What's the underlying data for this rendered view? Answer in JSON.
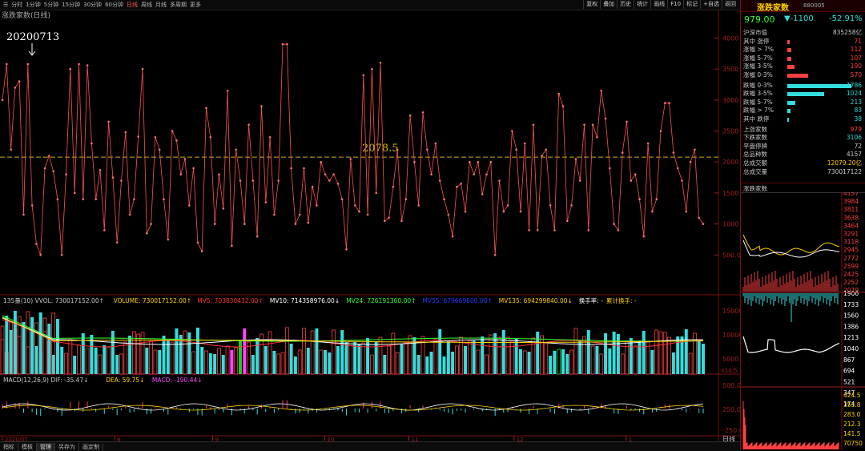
{
  "topbar": {
    "tabs": [
      "分时",
      "1分钟",
      "5分钟",
      "15分钟",
      "30分钟",
      "60分钟",
      "日线",
      "周线",
      "月线",
      "多周期",
      "更多"
    ],
    "active_index": 6,
    "right_buttons": [
      "复权",
      "叠加",
      "历史",
      "统计",
      "画线",
      "F10",
      "标记",
      "+自选",
      "返回"
    ]
  },
  "main": {
    "title": "涨跌家数(日线)",
    "date_label": "20200713",
    "avg_label": "2078.5",
    "avg_value": 2078.5,
    "y_ticks": [
      "4000",
      "3500",
      "3000",
      "2500",
      "2000",
      "1500",
      "1000",
      "500.0"
    ]
  },
  "chart_data": {
    "type": "line",
    "series": [
      {
        "values": [
          3000,
          3580,
          2200,
          3200,
          3300,
          1150,
          3580,
          1300,
          680,
          500,
          1900,
          2100,
          1850,
          1400,
          500,
          1800,
          3500,
          1500,
          3580,
          1400,
          3560,
          2300,
          1400,
          1870,
          900,
          2650,
          1750,
          700,
          1700,
          2480,
          1150,
          1400,
          2410,
          3500,
          850,
          1000,
          2400,
          2200,
          1400,
          750,
          2500,
          2350,
          1800,
          2050,
          1300,
          1900,
          700,
          560,
          2870,
          2400,
          1000,
          1800,
          1250,
          3150,
          650,
          2200,
          1700,
          1000,
          2600,
          1700,
          800,
          2900,
          1350,
          2400,
          1150,
          1700,
          3900,
          3900,
          1900,
          1000,
          1150,
          1900,
          1020,
          1600,
          1300,
          2000,
          1800,
          1700,
          1800,
          1650,
          1400,
          590,
          2050,
          1300,
          1200,
          3400,
          1150,
          3500,
          1500,
          3600,
          1050,
          1100,
          1600,
          2200,
          1050,
          1400,
          2750,
          2000,
          1300,
          2800,
          2200,
          1800,
          2300,
          1700,
          1400,
          1150,
          800,
          1600,
          1650,
          1200,
          2000,
          1800,
          2000,
          1480,
          1800,
          2000,
          500,
          1700,
          1200,
          1300,
          2500,
          2200,
          1200,
          2300,
          900,
          2600,
          900,
          2100,
          2200,
          1300,
          900,
          3100,
          2900,
          1050,
          1300,
          2050,
          1700,
          2600,
          900,
          2600,
          2400,
          3150,
          2700,
          1900,
          1000,
          900,
          2150,
          2650,
          1700,
          1800,
          1400,
          800,
          2300,
          1200,
          1400,
          2500,
          2950,
          2950,
          2150,
          1900,
          1700,
          1200,
          2000,
          2200,
          1100,
          1000
        ]
      }
    ]
  },
  "vol": {
    "legend": [
      {
        "text": "135量(10) VVOL: 730017152.00↑",
        "color": "#c8c8c8"
      },
      {
        "text": "VOLUME: 730017152.00↑",
        "color": "#ffd000"
      },
      {
        "text": "MV5: 703830432.00↑",
        "color": "#ff3333"
      },
      {
        "text": "MV10: 714358976.00↓",
        "color": "#ffffff"
      },
      {
        "text": "MV24: 726191360.00↑",
        "color": "#33ff33"
      },
      {
        "text": "MV55: 679669600.00↑",
        "color": "#2a3cff"
      },
      {
        "text": "MV135: 694299840.00↓",
        "color": "#ffd000"
      },
      {
        "text": "换手率: -",
        "color": "#ffffff"
      },
      {
        "text": "累计换手: -",
        "color": "#ffd000"
      }
    ],
    "y_ticks": [
      "15000",
      "10000",
      "5000"
    ],
    "unit": "X10万"
  },
  "macd": {
    "legend": [
      {
        "text": "MACD(12,26,9) DIF: -35.47↓",
        "color": "#c8c8c8"
      },
      {
        "text": "DEA: 59.75↓",
        "color": "#ffd000"
      },
      {
        "text": "MACD: -190.44↓",
        "color": "#ff44ff"
      }
    ],
    "y_ticks": [
      "500.0",
      "250.0",
      "-250.0"
    ]
  },
  "months": [
    "2020/07",
    "8",
    "9",
    "10",
    "11",
    "12",
    "1"
  ],
  "bottom_tabs": [
    "指标",
    "模板",
    "管理",
    "另存为",
    "画定制"
  ],
  "period_label": "日线",
  "right_panel": {
    "header": {
      "title": "涨跌家数",
      "code": "880005"
    },
    "price": {
      "value": "979.00",
      "change": "▼-1100",
      "pct": "-52.91%"
    },
    "stat_header": {
      "label": "沪深市值",
      "value": "835258亿"
    },
    "up_rows": [
      {
        "label": "其中 涨停",
        "value": "71"
      },
      {
        "label": "涨幅 > 7%",
        "value": "112"
      },
      {
        "label": "涨幅 5-7%",
        "value": "107"
      },
      {
        "label": "涨幅 3-5%",
        "value": "190"
      },
      {
        "label": "涨幅 0-3%",
        "value": "570"
      }
    ],
    "down_rows": [
      {
        "label": "跌幅 0-3%",
        "value": "1786"
      },
      {
        "label": "跌幅 3-5%",
        "value": "1024"
      },
      {
        "label": "跌幅 5-7%",
        "value": "213"
      },
      {
        "label": "跌幅 > 7%",
        "value": "83"
      },
      {
        "label": "其中 跌停",
        "value": "38"
      }
    ],
    "summary_rows": [
      {
        "label": "上涨家数",
        "value": "979"
      },
      {
        "label": "下跌家数",
        "value": "3106"
      },
      {
        "label": "平盘停牌",
        "value": "72"
      },
      {
        "label": "总品种数",
        "value": "4157"
      },
      {
        "label": "总成交额",
        "value": "12079.20亿"
      },
      {
        "label": "总成交量",
        "value": "730017122"
      }
    ],
    "mini_title": "涨跌家数",
    "mini_axis1": [
      "4157",
      "3984",
      "3811",
      "3638",
      "3464",
      "3291",
      "3118",
      "2945",
      "2772",
      "2599",
      "2425",
      "2252",
      "2079"
    ],
    "mini_axis2": [
      "1906",
      "1733",
      "1560",
      "1386",
      "1213",
      "1040",
      "867",
      "694",
      "521",
      "347",
      "174"
    ],
    "mini_axis3": [
      "424.5",
      "353.8",
      "283.0",
      "212.3",
      "141.5",
      "70750"
    ],
    "colors": {
      "up": "#ff4040",
      "down": "#33dddd",
      "accent": "#ffd000"
    }
  }
}
